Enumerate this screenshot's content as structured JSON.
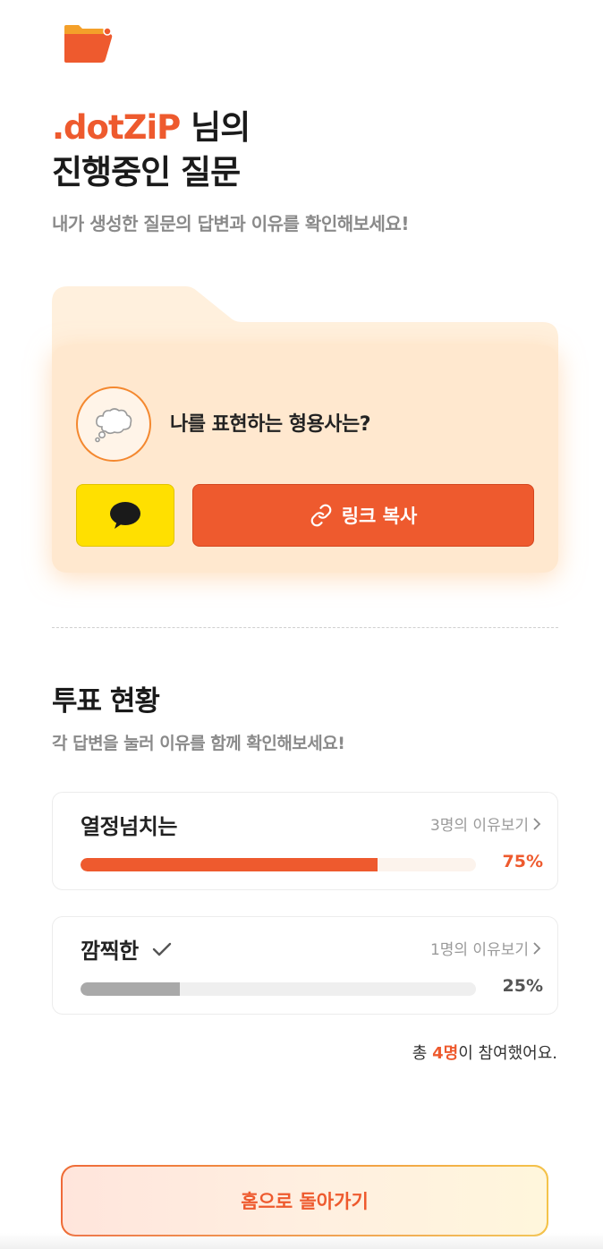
{
  "header": {
    "logo_icon": "folder-logo-icon",
    "brand_name": ".dotZiP",
    "title_suffix": " 님의",
    "title_line2": "진행중인 질문",
    "subtitle": "내가 생성한 질문의 답변과 이유를 확인해보세요!"
  },
  "question_card": {
    "icon": "thought-bubble-icon",
    "question": "나를 표현하는 형용사는?",
    "kakao_icon": "kakao-chat-icon",
    "link_icon": "link-icon",
    "copy_link_label": "링크 복사"
  },
  "vote": {
    "title": "투표 현황",
    "subtitle": "각 답변을 눌러 이유를 함께 확인해보세요!",
    "options": [
      {
        "label": "열정넘치는",
        "reason_link": "3명의 이유보기",
        "percent_label": "75%",
        "fraction": 0.75,
        "selected": false,
        "bar_color": "#ee5a2e",
        "pct_color": "#ee5a2e"
      },
      {
        "label": "깜찍한",
        "reason_link": "1명의 이유보기",
        "percent_label": "25%",
        "fraction": 0.25,
        "selected": true,
        "bar_color": "#a9a9a9",
        "pct_color": "#555555"
      }
    ],
    "total_prefix": "총 ",
    "total_count": "4명",
    "total_suffix": "이 참여했어요."
  },
  "footer": {
    "home_button": "홈으로 돌아가기"
  },
  "colors": {
    "accent": "#ee5a2e",
    "kakao": "#ffe000",
    "card_bg": "#ffe8cf"
  }
}
